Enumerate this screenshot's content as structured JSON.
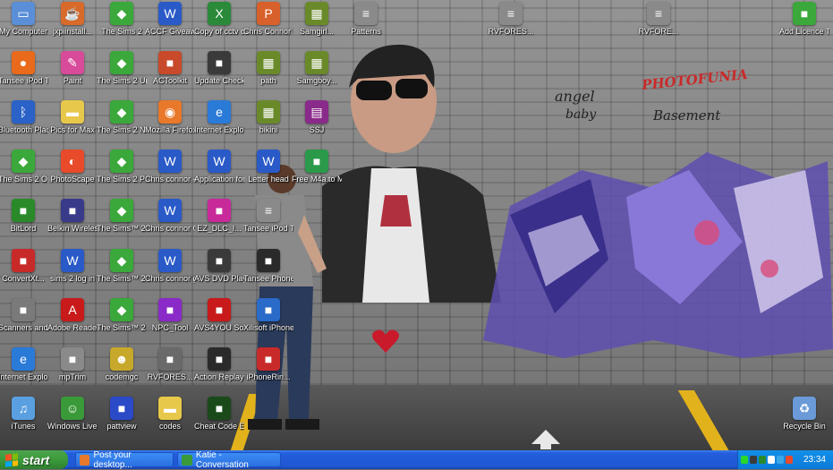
{
  "desktop": {
    "icons": [
      {
        "label": "My Computer",
        "icon": "my-computer-icon",
        "color": "#5a8fd8"
      },
      {
        "label": "Tansee iPod Transfer ...",
        "icon": "tansee-icon",
        "color": "#e86a1a"
      },
      {
        "label": "Bluetooth Places",
        "icon": "bluetooth-icon",
        "color": "#2a62c8"
      },
      {
        "label": "The Sims 2 Open For...",
        "icon": "sims-icon",
        "color": "#3aa83a"
      },
      {
        "label": "BitLord",
        "icon": "bitlord-icon",
        "color": "#2a8a2a"
      },
      {
        "label": "ConvertXt...",
        "icon": "convertx-icon",
        "color": "#c82a2a"
      },
      {
        "label": "Scanners and Ca...",
        "icon": "scanner-icon",
        "color": "#7a7a7a"
      },
      {
        "label": "Internet Explorer",
        "icon": "ie-icon",
        "color": "#2a7ad8"
      },
      {
        "label": "iTunes",
        "icon": "itunes-icon",
        "color": "#5aa0e0"
      },
      {
        "label": "jxpiinstall...",
        "icon": "java-icon",
        "color": "#d86a2a"
      },
      {
        "label": "Paint",
        "icon": "paint-icon",
        "color": "#d84a9a"
      },
      {
        "label": "Pics for Max",
        "icon": "folder-icon",
        "color": "#e8c84a"
      },
      {
        "label": "PhotoScape",
        "icon": "photoscape-icon",
        "color": "#e84a2a"
      },
      {
        "label": "Belkin Wireles...",
        "icon": "belkin-icon",
        "color": "#3a3a8a"
      },
      {
        "label": "sims 2 log in",
        "icon": "word-doc-icon",
        "color": "#2a5ac8"
      },
      {
        "label": "Adobe Reader 9",
        "icon": "adobe-reader-icon",
        "color": "#c81a1a"
      },
      {
        "label": "mpTrim",
        "icon": "mptrim-icon",
        "color": "#8a8a8a"
      },
      {
        "label": "Windows Live Mes...",
        "icon": "messenger-icon",
        "color": "#3a9a3a"
      },
      {
        "label": "The Sims 2",
        "icon": "sims-icon",
        "color": "#3aa83a"
      },
      {
        "label": "The Sims 2 University",
        "icon": "sims-icon",
        "color": "#3aa83a"
      },
      {
        "label": "The Sims 2 Nightlife",
        "icon": "sims-icon",
        "color": "#3aa83a"
      },
      {
        "label": "The Sims 2 Pets",
        "icon": "sims-icon",
        "color": "#3aa83a"
      },
      {
        "label": "The Sims™ 2 Seasons",
        "icon": "sims-icon",
        "color": "#3aa83a"
      },
      {
        "label": "The Sims™ 2 Bon Vo...",
        "icon": "sims-icon",
        "color": "#3aa83a"
      },
      {
        "label": "The Sims™ 2 FreeTime",
        "icon": "sims-icon",
        "color": "#3aa83a"
      },
      {
        "label": "codemgc",
        "icon": "codemgc-icon",
        "color": "#c8a82a"
      },
      {
        "label": "pattview",
        "icon": "pattview-icon",
        "color": "#2a4ac8"
      },
      {
        "label": "ACCF Giveaway!",
        "icon": "word-doc-icon",
        "color": "#2a5ac8"
      },
      {
        "label": "ACToolkit",
        "icon": "actoolkit-icon",
        "color": "#c84a2a"
      },
      {
        "label": "Mozilla Firefox",
        "icon": "firefox-icon",
        "color": "#e8782a"
      },
      {
        "label": "Chris connor - ...",
        "icon": "word-doc-icon",
        "color": "#2a5ac8"
      },
      {
        "label": "Chris connor CV 1",
        "icon": "word-doc-icon",
        "color": "#2a5ac8"
      },
      {
        "label": "Chris connor g4s",
        "icon": "word-doc-icon",
        "color": "#2a5ac8"
      },
      {
        "label": "NPC_Tool",
        "icon": "npc-tool-icon",
        "color": "#8a2ac8"
      },
      {
        "label": "RVFORES...",
        "icon": "rvfores-icon",
        "color": "#6a6a6a"
      },
      {
        "label": "codes",
        "icon": "folder-icon",
        "color": "#e8c84a"
      },
      {
        "label": "Copy of cctv contacts",
        "icon": "excel-doc-icon",
        "color": "#2a8a3a"
      },
      {
        "label": "Update Checker",
        "icon": "update-checker-icon",
        "color": "#3a3a3a"
      },
      {
        "label": "Internet Explorer",
        "icon": "ie-icon",
        "color": "#2a7ad8"
      },
      {
        "label": "Application form (S...",
        "icon": "word-doc-icon",
        "color": "#2a5ac8"
      },
      {
        "label": "EZ_DLC_I...",
        "icon": "ez-dlc-icon",
        "color": "#c82a9a"
      },
      {
        "label": "AVS DVD Player",
        "icon": "avs-dvd-icon",
        "color": "#3a3a3a"
      },
      {
        "label": "AVS4YOU Softwa...",
        "icon": "avs4you-icon",
        "color": "#c81a1a"
      },
      {
        "label": "Action Replay Co...",
        "icon": "action-replay-icon",
        "color": "#2a2a2a"
      },
      {
        "label": "Cheat Code Editor",
        "icon": "cheat-editor-icon",
        "color": "#1a4a1a"
      },
      {
        "label": "Chris Connor Pri...",
        "icon": "powerpoint-doc-icon",
        "color": "#d8602a"
      },
      {
        "label": "path",
        "icon": "winrar-sfx-icon",
        "color": "#6a8a2a"
      },
      {
        "label": "bikini",
        "icon": "winrar-sfx-icon",
        "color": "#6a8a2a"
      },
      {
        "label": "Letter head",
        "icon": "word-doc-icon",
        "color": "#2a5ac8"
      },
      {
        "label": "Tansee iPod Transfer",
        "icon": "document-icon",
        "color": "#8a8a8a"
      },
      {
        "label": "Tansee Phone Copy",
        "icon": "tansee-phone-icon",
        "color": "#2a2a2a"
      },
      {
        "label": "Xilisoft iPhone...",
        "icon": "xilisoft-icon",
        "color": "#2a6ac8"
      },
      {
        "label": "iPhoneRin...",
        "icon": "iphone-ringtone-icon",
        "color": "#c82a2a"
      },
      {
        "label": "Samgirl...",
        "icon": "winrar-sfx-icon",
        "color": "#6a8a2a"
      },
      {
        "label": "Samgboy...",
        "icon": "winrar-sfx-icon",
        "color": "#6a8a2a"
      },
      {
        "label": "SSJ",
        "icon": "winrar-icon",
        "color": "#8a2a8a"
      },
      {
        "label": "Free M4a to MP3 Converter",
        "icon": "m4a-converter-icon",
        "color": "#2a9a4a"
      },
      {
        "label": "Patterns",
        "icon": "document-icon",
        "color": "#8a8a8a"
      },
      {
        "label": "RVFORES...",
        "icon": "document-icon",
        "color": "#8a8a8a"
      },
      {
        "label": "RVFORE...",
        "icon": "document-icon",
        "color": "#8a8a8a"
      },
      {
        "label": "Add Licence To Your ...",
        "icon": "add-licence-icon",
        "color": "#3aa83a"
      },
      {
        "label": "Recycle Bin",
        "icon": "recycle-bin-icon",
        "color": "#6a9ad8"
      }
    ],
    "wall_text": {
      "photofunia": "PHOTOFUNIA",
      "angel": "angel",
      "baby": "baby",
      "basement": "Basement"
    }
  },
  "taskbar": {
    "start_label": "start",
    "tasks": [
      {
        "label": "Post your desktop...",
        "icon": "firefox-icon",
        "color": "#e8782a"
      },
      {
        "label": "Katie - Conversation",
        "icon": "messenger-icon",
        "color": "#3a9a3a"
      }
    ],
    "clock": "23:34",
    "tray_colors": [
      "#2ad82a",
      "#3a3a3a",
      "#2a8a2a",
      "#ffffff",
      "#3aa8e8",
      "#e84a2a",
      "#8ad8ff"
    ]
  }
}
